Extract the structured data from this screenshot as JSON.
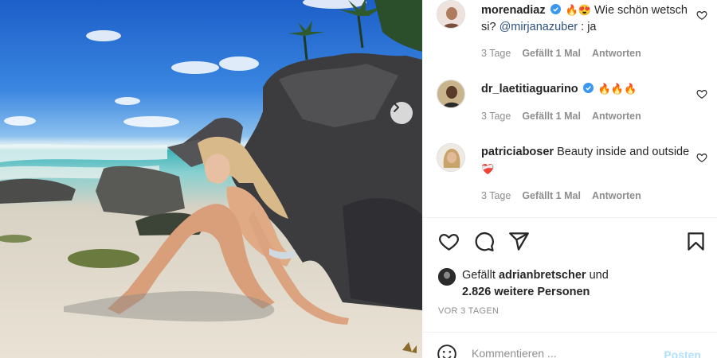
{
  "comments": [
    {
      "username": "morenadiaz",
      "verified": true,
      "emoji": "🔥😍",
      "text": " Wie schön wetsch si? ",
      "mention": "@mirjanazuber",
      "text_after": " : ja",
      "time": "3 Tage",
      "likes": "Gefällt 1 Mal",
      "reply": "Antworten"
    },
    {
      "username": "dr_laetitiaguarino",
      "verified": true,
      "emoji": "🔥🔥🔥",
      "text": "",
      "time": "3 Tage",
      "likes": "Gefällt 1 Mal",
      "reply": "Antworten"
    },
    {
      "username": "patriciaboser",
      "verified": false,
      "text": " Beauty inside and outside ",
      "emoji": "❤️‍🩹",
      "time": "3 Tage",
      "likes": "Gefällt 1 Mal",
      "reply": "Antworten"
    }
  ],
  "actions": {
    "like": "heart-icon",
    "comment": "comment-icon",
    "share": "paper-plane-icon",
    "save": "bookmark-icon"
  },
  "liked_by": {
    "prefix": "Gefällt ",
    "user": "adrianbretscher",
    "middle": " und",
    "others": "2.826 weitere Personen"
  },
  "time_ago": "VOR 3 TAGEN",
  "add_comment": {
    "placeholder": "Kommentieren ...",
    "post_label": "Posten"
  },
  "colors": {
    "verified_blue": "#3897f0",
    "post_disabled": "#b2dffc",
    "meta_gray": "#8e8e8e"
  }
}
